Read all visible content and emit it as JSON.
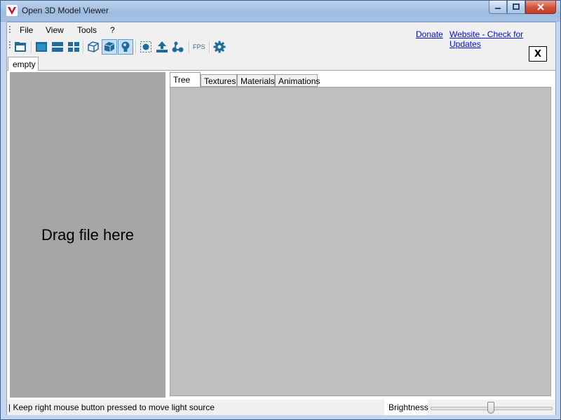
{
  "window": {
    "title": "Open 3D Model Viewer"
  },
  "menu": {
    "file": "File",
    "view": "View",
    "tools": "Tools",
    "help": "?"
  },
  "links": {
    "donate": "Donate",
    "website": "Website - Check for Updates"
  },
  "toolbar": {
    "fps": "FPS",
    "close": "X"
  },
  "doc_tab": {
    "label": "empty"
  },
  "drop": {
    "label": "Drag file here"
  },
  "inner_tabs": [
    "Tree",
    "Textures",
    "Materials",
    "Animations"
  ],
  "status": {
    "text": "| Keep right mouse button pressed to move light source",
    "brightness_label": "Brightness",
    "brightness": 0.5
  },
  "colors": {
    "accent": "#1f6c9c",
    "link": "#0010cc"
  }
}
